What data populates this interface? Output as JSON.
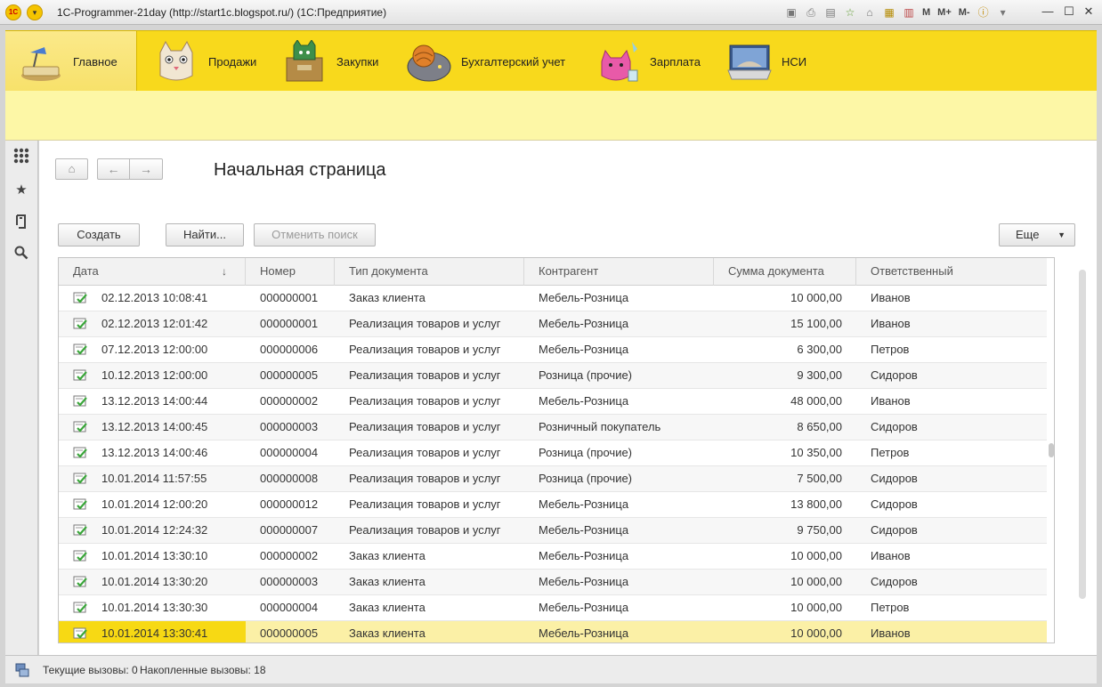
{
  "window": {
    "title": "1С-Programmer-21day (http://start1c.blogspot.ru/)  (1С:Предприятие)",
    "toolbar_texts": [
      "M",
      "M+",
      "M-"
    ]
  },
  "sections": [
    {
      "label": "Главное",
      "icon": "desk-lamp-icon",
      "active": true
    },
    {
      "label": "Продажи",
      "icon": "cat-sales-icon",
      "active": false
    },
    {
      "label": "Закупки",
      "icon": "cat-box-icon",
      "active": false
    },
    {
      "label": "Бухгалтерский учет",
      "icon": "cat-ball-icon",
      "active": false
    },
    {
      "label": "Зарплата",
      "icon": "cat-pink-icon",
      "active": false
    },
    {
      "label": "НСИ",
      "icon": "cat-laptop-icon",
      "active": false
    }
  ],
  "page": {
    "title": "Начальная страница"
  },
  "buttons": {
    "create": "Создать",
    "find": "Найти...",
    "cancel_search": "Отменить поиск",
    "more": "Еще"
  },
  "table": {
    "columns": [
      "Дата",
      "Номер",
      "Тип документа",
      "Контрагент",
      "Сумма документа",
      "Ответственный"
    ],
    "rows": [
      {
        "date": "02.12.2013 10:08:41",
        "number": "000000001",
        "doc_type": "Заказ клиента",
        "contractor": "Мебель-Розница",
        "sum": "10 000,00",
        "responsible": "Иванов"
      },
      {
        "date": "02.12.2013 12:01:42",
        "number": "000000001",
        "doc_type": "Реализация товаров и услуг",
        "contractor": "Мебель-Розница",
        "sum": "15 100,00",
        "responsible": "Иванов"
      },
      {
        "date": "07.12.2013 12:00:00",
        "number": "000000006",
        "doc_type": "Реализация товаров и услуг",
        "contractor": "Мебель-Розница",
        "sum": "6 300,00",
        "responsible": "Петров"
      },
      {
        "date": "10.12.2013 12:00:00",
        "number": "000000005",
        "doc_type": "Реализация товаров и услуг",
        "contractor": "Розница (прочие)",
        "sum": "9 300,00",
        "responsible": "Сидоров"
      },
      {
        "date": "13.12.2013 14:00:44",
        "number": "000000002",
        "doc_type": "Реализация товаров и услуг",
        "contractor": "Мебель-Розница",
        "sum": "48 000,00",
        "responsible": "Иванов"
      },
      {
        "date": "13.12.2013 14:00:45",
        "number": "000000003",
        "doc_type": "Реализация товаров и услуг",
        "contractor": "Розничный покупатель",
        "sum": "8 650,00",
        "responsible": "Сидоров"
      },
      {
        "date": "13.12.2013 14:00:46",
        "number": "000000004",
        "doc_type": "Реализация товаров и услуг",
        "contractor": "Розница (прочие)",
        "sum": "10 350,00",
        "responsible": "Петров"
      },
      {
        "date": "10.01.2014 11:57:55",
        "number": "000000008",
        "doc_type": "Реализация товаров и услуг",
        "contractor": "Розница (прочие)",
        "sum": "7 500,00",
        "responsible": "Сидоров"
      },
      {
        "date": "10.01.2014 12:00:20",
        "number": "000000012",
        "doc_type": "Реализация товаров и услуг",
        "contractor": "Мебель-Розница",
        "sum": "13 800,00",
        "responsible": "Сидоров"
      },
      {
        "date": "10.01.2014 12:24:32",
        "number": "000000007",
        "doc_type": "Реализация товаров и услуг",
        "contractor": "Мебель-Розница",
        "sum": "9 750,00",
        "responsible": "Сидоров"
      },
      {
        "date": "10.01.2014 13:30:10",
        "number": "000000002",
        "doc_type": "Заказ клиента",
        "contractor": "Мебель-Розница",
        "sum": "10 000,00",
        "responsible": "Иванов"
      },
      {
        "date": "10.01.2014 13:30:20",
        "number": "000000003",
        "doc_type": "Заказ клиента",
        "contractor": "Мебель-Розница",
        "sum": "10 000,00",
        "responsible": "Сидоров"
      },
      {
        "date": "10.01.2014 13:30:30",
        "number": "000000004",
        "doc_type": "Заказ клиента",
        "contractor": "Мебель-Розница",
        "sum": "10 000,00",
        "responsible": "Петров"
      },
      {
        "date": "10.01.2014 13:30:41",
        "number": "000000005",
        "doc_type": "Заказ клиента",
        "contractor": "Мебель-Розница",
        "sum": "10 000,00",
        "responsible": "Иванов",
        "selected": true
      }
    ]
  },
  "status": {
    "current_calls": "Текущие вызовы: 0",
    "accumulated_calls": "Накопленные вызовы: 18"
  },
  "colors": {
    "section_yellow": "#f8d91c",
    "subpanel_yellow": "#fdf7a6",
    "selected_row": "#fbf0a6",
    "selected_cell": "#f7d914",
    "posted_check": "#3aa63a"
  }
}
